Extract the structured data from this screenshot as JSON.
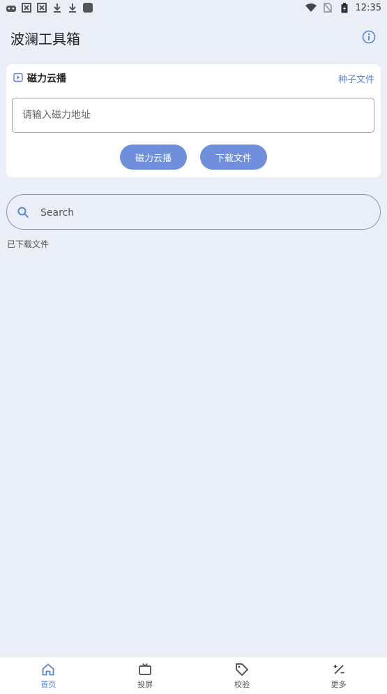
{
  "status_bar": {
    "time": "12:35"
  },
  "header": {
    "title": "波澜工具箱",
    "icon": "info-icon"
  },
  "magnet_card": {
    "title": "磁力云播",
    "seed_link": "种子文件",
    "input_placeholder": "请输入磁力地址",
    "stream_button": "磁力云播",
    "download_button": "下载文件"
  },
  "search": {
    "placeholder": "Search"
  },
  "downloaded_label": "已下载文件",
  "bottom_nav": {
    "items": [
      {
        "label": "首页",
        "icon": "home-icon",
        "active": true
      },
      {
        "label": "投屏",
        "icon": "tv-icon",
        "active": false
      },
      {
        "label": "校验",
        "icon": "tag-icon",
        "active": false
      },
      {
        "label": "更多",
        "icon": "percent-icon",
        "active": false
      }
    ]
  },
  "colors": {
    "accent": "#5b82d6",
    "button": "#6f8fdd",
    "background": "#eaeef7"
  }
}
